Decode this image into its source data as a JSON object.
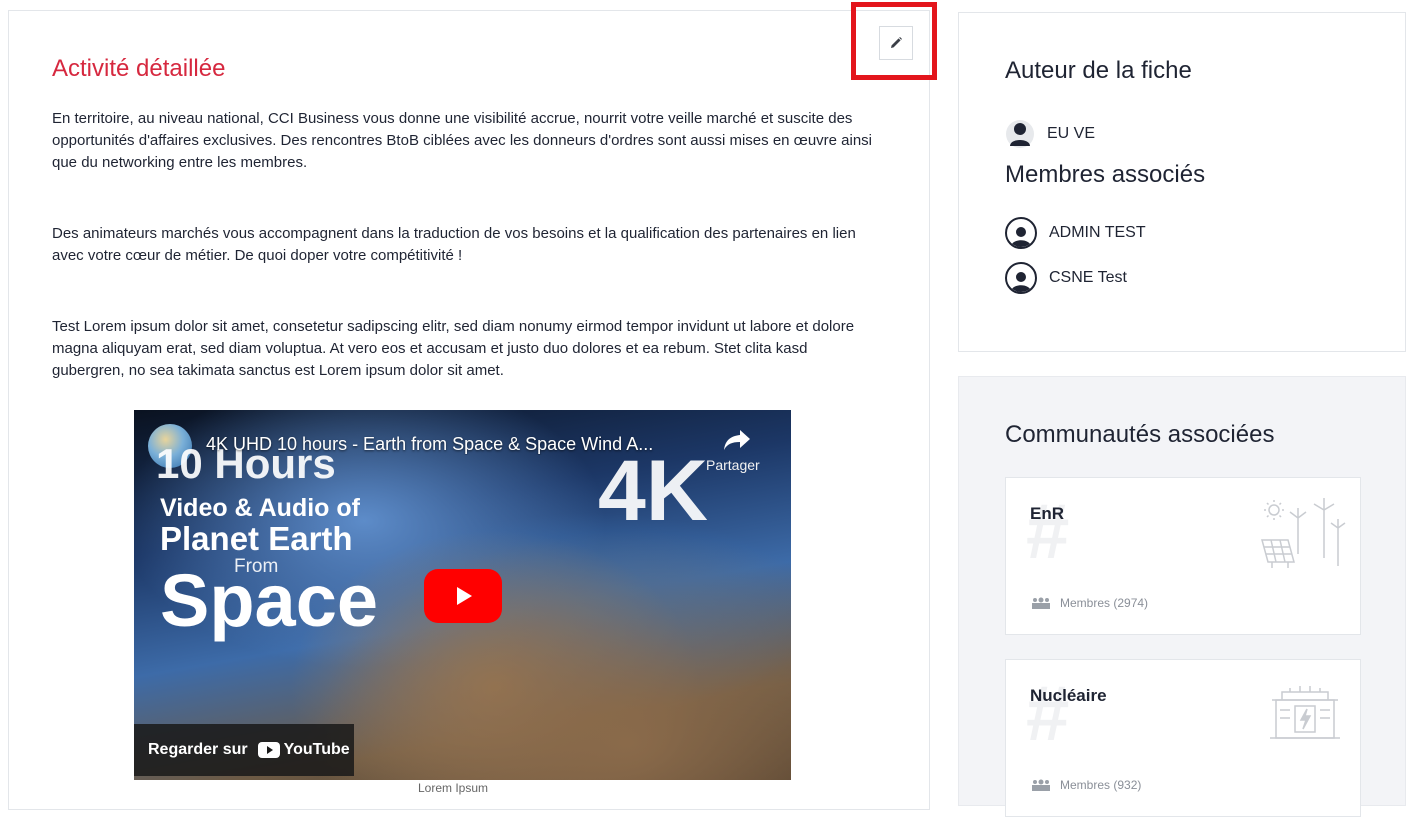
{
  "main": {
    "title": "Activité détaillée",
    "edit_icon": "pencil-icon",
    "paragraphs": [
      "En territoire, au niveau national, CCI Business vous donne une visibilité accrue, nourrit votre veille marché et suscite des opportunités d'affaires exclusives. Des rencontres BtoB ciblées avec les donneurs d'ordres sont aussi mises en œuvre ainsi que du networking entre les membres.",
      "Des animateurs marchés vous accompagnent dans la traduction de vos besoins et la qualification des partenaires en lien avec votre cœur de métier. De quoi doper votre compétitivité !",
      "Test Lorem ipsum dolor sit amet, consetetur sadipscing elitr, sed diam nonumy eirmod tempor invidunt ut labore et dolore magna aliquyam erat, sed diam voluptua. At vero eos et accusam et justo duo dolores et ea rebum. Stet clita kasd gubergren, no sea takimata sanctus est Lorem ipsum dolor sit amet."
    ],
    "video": {
      "title": "4K UHD 10 hours - Earth from Space & Space Wind A...",
      "share_label": "Partager",
      "overlay": {
        "hours": "10 Hours",
        "line1": "Video & Audio of",
        "line2": "Planet Earth",
        "line3": "From",
        "line4": "Space",
        "badge": "4K"
      },
      "watch_on": "Regarder sur",
      "youtube": "YouTube",
      "caption": "Lorem Ipsum"
    }
  },
  "author_card": {
    "heading": "Auteur de la fiche",
    "author": "EU VE",
    "members_heading": "Membres associés",
    "members": [
      "ADMIN TEST",
      "CSNE Test"
    ]
  },
  "communities": {
    "heading": "Communautés associées",
    "items": [
      {
        "name": "EnR",
        "members": "Membres (2974)",
        "icon": "renewable-energy-icon"
      },
      {
        "name": "Nucléaire",
        "members": "Membres (932)",
        "icon": "nuclear-plant-icon"
      }
    ]
  },
  "colors": {
    "accent": "#d6283f",
    "highlight": "#e3151c",
    "text": "#1f2433",
    "panel_bg": "#f3f4f7"
  }
}
